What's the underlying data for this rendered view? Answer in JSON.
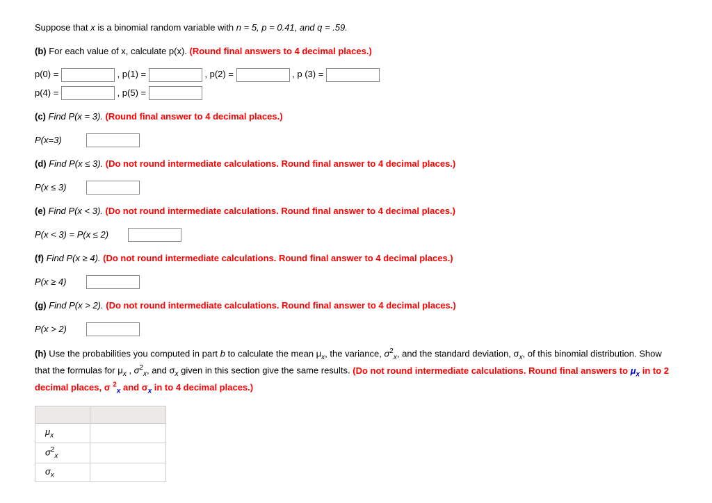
{
  "intro": {
    "prefix": "Suppose that ",
    "var": "x",
    "mid": " is a binomial random variable with ",
    "params": "n = 5, p = 0.41, and q = .59."
  },
  "b": {
    "label": "(b)",
    "text": " For each value of x, calculate p(x). ",
    "hint": "(Round final answers to 4 decimal places.)",
    "p0": "p(0) = ",
    "p1": ", p(1) = ",
    "p2": ", p(2) = ",
    "p3": ", p (3) = ",
    "p4": "p(4) = ",
    "p5": ", p(5) = "
  },
  "c": {
    "label": "(c)",
    "text": " Find P(x = 3). ",
    "hint": "(Round final answer to 4 decimal places.)",
    "answer_label": "P(x=3)"
  },
  "d": {
    "label": "(d)",
    "text": " Find P(x ≤ 3). ",
    "hint": "(Do not round intermediate calculations. Round final answer to 4 decimal places.)",
    "answer_label": "P(x ≤ 3)"
  },
  "e": {
    "label": "(e)",
    "text": " Find P(x < 3). ",
    "hint": "(Do not round intermediate calculations. Round final answer to 4 decimal places.)",
    "answer_label": "P(x < 3) = P(x ≤ 2)"
  },
  "f": {
    "label": "(f)",
    "text": " Find P(x ≥ 4). ",
    "hint": "(Do not round intermediate calculations. Round final answer to 4 decimal places.)",
    "answer_label": "P(x ≥ 4)"
  },
  "g": {
    "label": "(g)",
    "text": " Find P(x > 2). ",
    "hint": "(Do not round intermediate calculations. Round final answer to 4 decimal places.)",
    "answer_label": "P(x > 2)"
  },
  "h": {
    "label": "(h)",
    "text1": " Use the probabilities you computed in part ",
    "part_ref": "b",
    "text2": " to calculate the mean μ",
    "text3": ", the variance, ",
    "text4": ", and the standard deviation, σ",
    "text5": ", of this binomial distribution. Show that the formulas for μ",
    "text6": " , ",
    "text7": ", and σ",
    "text8": " given in this section give the same results. ",
    "hint1": "(Do not round intermediate calculations. Round final answers to ",
    "hint_mu": "μ",
    "hint2": " in to 2 decimal places, σ ",
    "hint_sup": "2",
    "hint3": " and σ",
    "hint4": " in to 4 decimal places.)",
    "row1": "μ",
    "row1_sub": "x",
    "row2_pre": "σ",
    "row2_sup": "2",
    "row2_sub": "x",
    "row3": "σ",
    "row3_sub": "x"
  }
}
